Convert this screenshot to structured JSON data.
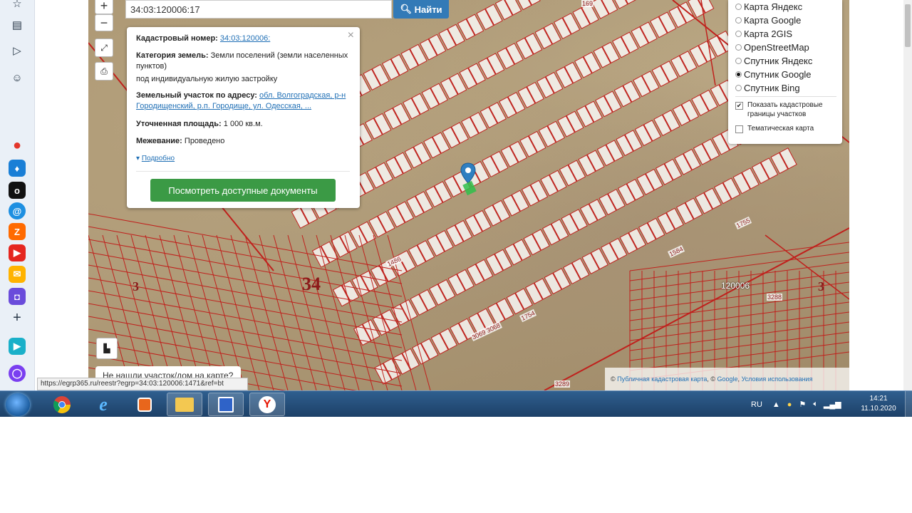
{
  "search": {
    "value": "34:03:120006:17",
    "button": "Найти"
  },
  "popup": {
    "cad_label": "Кадастровый номер:",
    "cad_value": "34:03:120006:",
    "cat_label": "Категория земель:",
    "cat_value": "Земли поселений (земли населенных пунктов)",
    "cat_use": "под индивидуальную жилую застройку",
    "addr_label": "Земельный участок по адресу:",
    "addr_value": "обл. Волгоградская, р-н Городищенский, р.п. Городище, ул. Одесская, ...",
    "area_label": "Уточненная площадь:",
    "area_value": "1 000 кв.м.",
    "survey_label": "Межевание:",
    "survey_value": "Проведено",
    "details": "Подробно",
    "docs_button": "Посмотреть доступные документы"
  },
  "layers": {
    "options": [
      "Карта Яндекс",
      "Карта Google",
      "Карта 2GIS",
      "OpenStreetMap",
      "Спутник Яндекс",
      "Спутник Google",
      "Спутник Bing"
    ],
    "selected": "Спутник Google",
    "show_borders": "Показать кадастровые границы участков",
    "thematic": "Тематическая карта"
  },
  "map_labels": {
    "quarter_34": "34",
    "quarter_3_left": "3",
    "quarter_3_right": "3",
    "block": "120006",
    "n3288": "3288",
    "n3289": "3289",
    "n1754": "1754",
    "n1755": "1755",
    "n1584": "1584",
    "n1486": "1486",
    "n169": "169",
    "n3069": "3069 3068"
  },
  "not_found": "Не нашли участок/дом на карте?",
  "attribution": {
    "prefix": "©",
    "pkk": "Публичная кадастровая карта",
    "sep": ", ©",
    "google": "Google",
    "terms": "Условия использования"
  },
  "status_url": "https://egrp365.ru/reestr?egrp=34:03:120006:1471&ref=bt",
  "taskbar": {
    "lang": "RU",
    "time": "14:21",
    "date": "11.10.2020"
  }
}
